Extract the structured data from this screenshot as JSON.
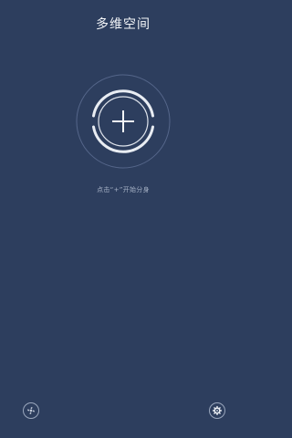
{
  "app": {
    "title": "多维空间"
  },
  "main": {
    "add_button": {
      "icon": "plus-icon"
    },
    "hint": "点击“+”开始分身"
  },
  "footer": {
    "left_button": {
      "icon": "fan-icon"
    },
    "right_button": {
      "icon": "gear-icon"
    }
  },
  "colors": {
    "background": "#2d3e5e",
    "title": "#f3f5f8",
    "ring": "#e9edf3",
    "ring_faint": "#5d6d88",
    "hint": "#a6b2c6"
  }
}
